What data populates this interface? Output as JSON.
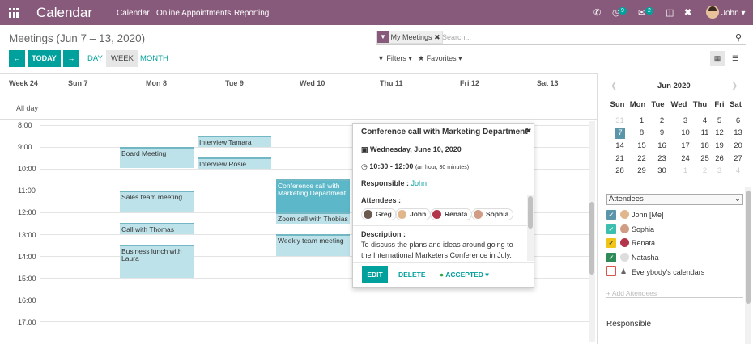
{
  "topbar": {
    "app": "Calendar",
    "menus": [
      "Calendar",
      "Online Appointments",
      "Reporting"
    ],
    "activity_count": "9",
    "message_count": "2",
    "user": "John"
  },
  "control": {
    "title": "Meetings (Jun 7 – 13, 2020)",
    "facet": "My Meetings",
    "search_placeholder": "Search...",
    "today": "TODAY",
    "prev": "←",
    "next": "→",
    "scales": [
      "DAY",
      "WEEK",
      "MONTH"
    ],
    "filters": "Filters",
    "favorites": "Favorites"
  },
  "calendar": {
    "week_label": "Week 24",
    "days": [
      "Sun 7",
      "Mon 8",
      "Tue 9",
      "Wed 10",
      "Thu 11",
      "Fri 12",
      "Sat 13"
    ],
    "allday": "All day",
    "hours": [
      "8:00",
      "9:00",
      "10:00",
      "11:00",
      "12:00",
      "13:00",
      "14:00",
      "15:00",
      "16:00",
      "17:00"
    ],
    "events": [
      {
        "title": "Board Meeting"
      },
      {
        "title": "Interview Tamara"
      },
      {
        "title": "Interview Rosie"
      },
      {
        "title": "Sales team meeting"
      },
      {
        "title": "Call with Thomas"
      },
      {
        "title": "Business lunch with Laura"
      },
      {
        "title": "Conference call with Marketing Department"
      },
      {
        "title": "Zoom call with Thobias"
      },
      {
        "title": "Weekly team meeting"
      }
    ]
  },
  "popover": {
    "title": "Conference call with Marketing Department",
    "date": "Wednesday, June 10, 2020",
    "time": "10:30 - 12:00",
    "duration": "(an hour, 30 minutes)",
    "responsible_label": "Responsible :",
    "responsible": "John",
    "attendees_label": "Attendees :",
    "attendees": [
      "Greg",
      "John",
      "Renata",
      "Sophia"
    ],
    "description_label": "Description :",
    "description": "To discuss the plans and ideas around going to the International Marketers Conference in July.",
    "edit": "EDIT",
    "delete": "DELETE",
    "status": "ACCEPTED"
  },
  "sidebar": {
    "month": "Jun 2020",
    "weekdays": [
      "Sun",
      "Mon",
      "Tue",
      "Wed",
      "Thu",
      "Fri",
      "Sat"
    ],
    "weeks": [
      [
        "31",
        "1",
        "2",
        "3",
        "4",
        "5",
        "6"
      ],
      [
        "7",
        "8",
        "9",
        "10",
        "11",
        "12",
        "13"
      ],
      [
        "14",
        "15",
        "16",
        "17",
        "18",
        "19",
        "20"
      ],
      [
        "21",
        "22",
        "23",
        "24",
        "25",
        "26",
        "27"
      ],
      [
        "28",
        "29",
        "30",
        "1",
        "2",
        "3",
        "4"
      ]
    ],
    "attendees_select": "Attendees",
    "attendees": [
      "John [Me]",
      "Sophia",
      "Renata",
      "Natasha",
      "Everybody's calendars"
    ],
    "add_attendees": "+ Add Attendees",
    "responsible": "Responsible"
  },
  "colors": {
    "brand": "#875a7b",
    "accent": "#00a09d",
    "event": "#bde2ea",
    "selected_event": "#5cb8c8"
  }
}
